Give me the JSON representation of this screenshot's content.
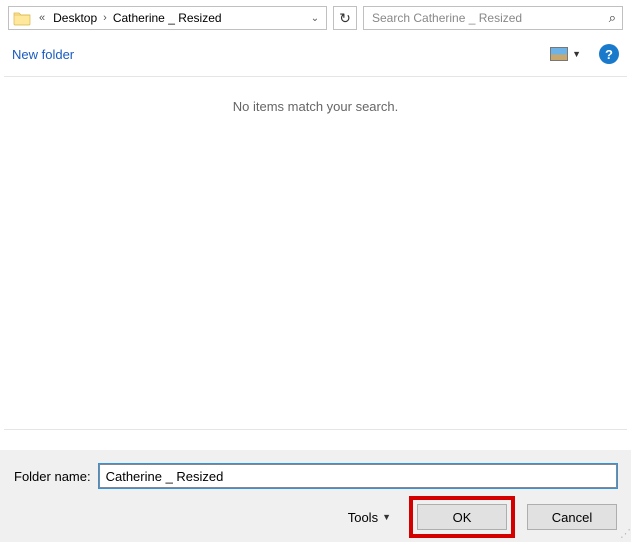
{
  "breadcrumb": {
    "prev_indicator": "«",
    "items": [
      "Desktop",
      "Catherine _ Resized"
    ]
  },
  "search": {
    "placeholder": "Search Catherine _ Resized"
  },
  "subbar": {
    "new_folder": "New folder"
  },
  "content": {
    "empty_message": "No items match your search."
  },
  "footer": {
    "folder_name_label": "Folder name:",
    "folder_name_value": "Catherine _ Resized",
    "tools_label": "Tools",
    "ok_label": "OK",
    "cancel_label": "Cancel"
  },
  "help_glyph": "?"
}
